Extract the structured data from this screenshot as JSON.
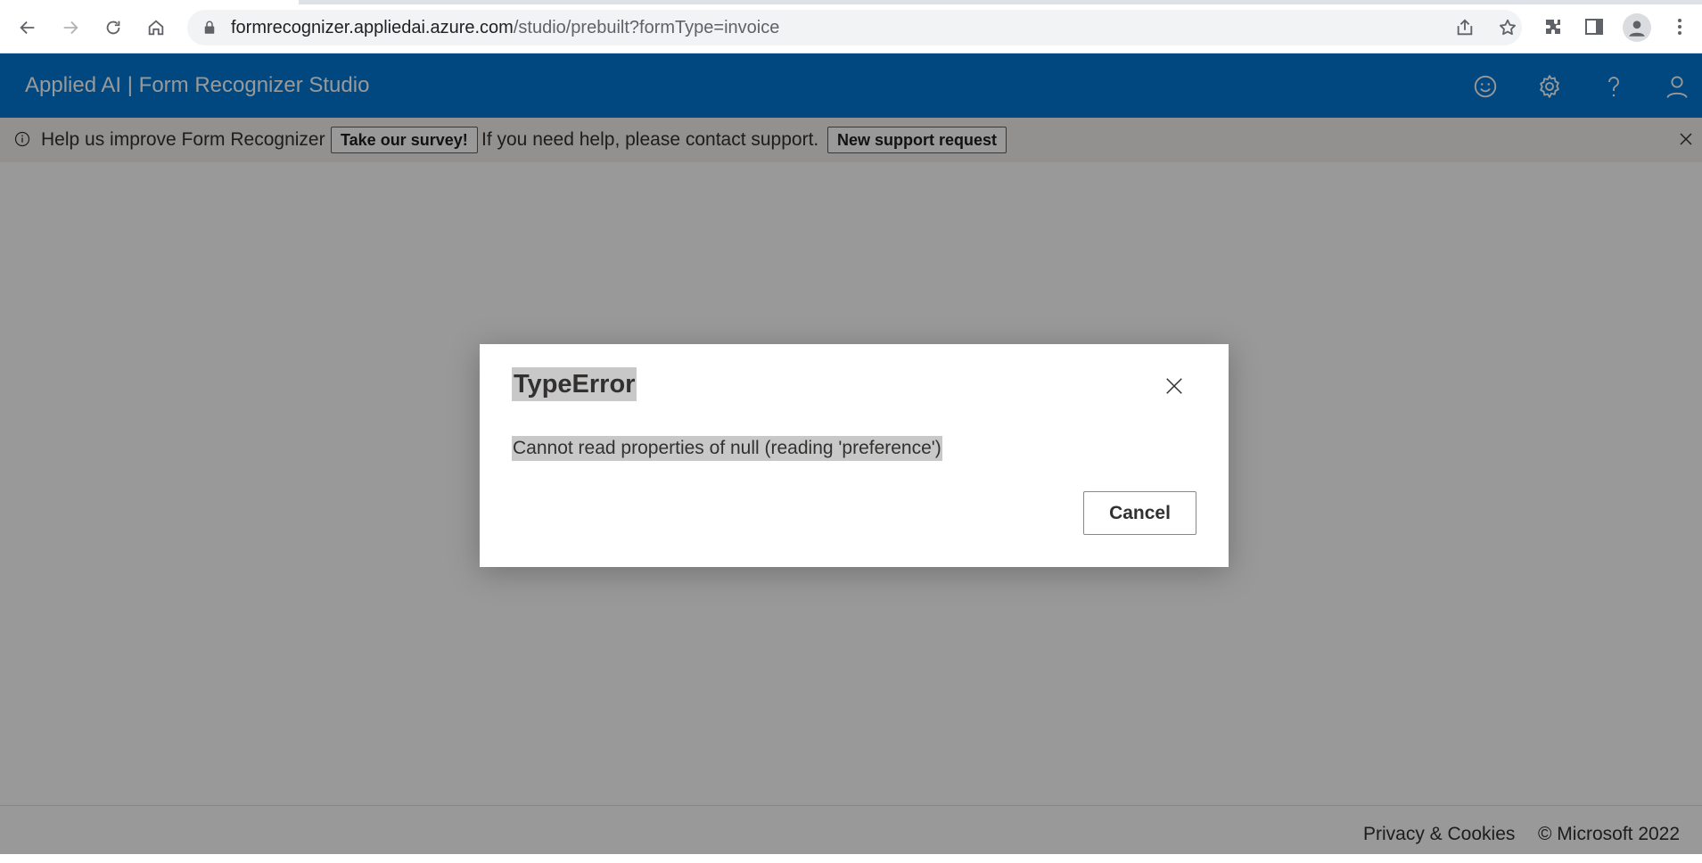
{
  "browser": {
    "url_host": "formrecognizer.appliedai.azure.com",
    "url_path": "/studio/prebuilt?formType=invoice",
    "icons": [
      "back-icon",
      "forward-icon",
      "reload-icon",
      "home-icon",
      "lock-icon",
      "share-icon",
      "star-icon",
      "extensions-icon",
      "side-panel-icon",
      "profile-icon",
      "menu-icon"
    ]
  },
  "header": {
    "title": "Applied AI | Form Recognizer Studio",
    "icons": [
      "smiley-icon",
      "gear-icon",
      "help-icon",
      "person-icon"
    ]
  },
  "infobar": {
    "message": "Help us improve Form Recognizer",
    "survey_button": "Take our survey!",
    "help_text": "If you need help, please contact support.",
    "support_button": "New support request"
  },
  "dialog": {
    "title": "TypeError",
    "message": "Cannot read properties of null (reading 'preference')",
    "cancel_label": "Cancel"
  },
  "footer": {
    "privacy": "Privacy & Cookies",
    "copyright": "© Microsoft 2022"
  },
  "colors": {
    "header_blue": "#0078d4",
    "overlay": "rgba(0,0,0,0.40)",
    "selection_highlight": "#c8c8c8"
  }
}
